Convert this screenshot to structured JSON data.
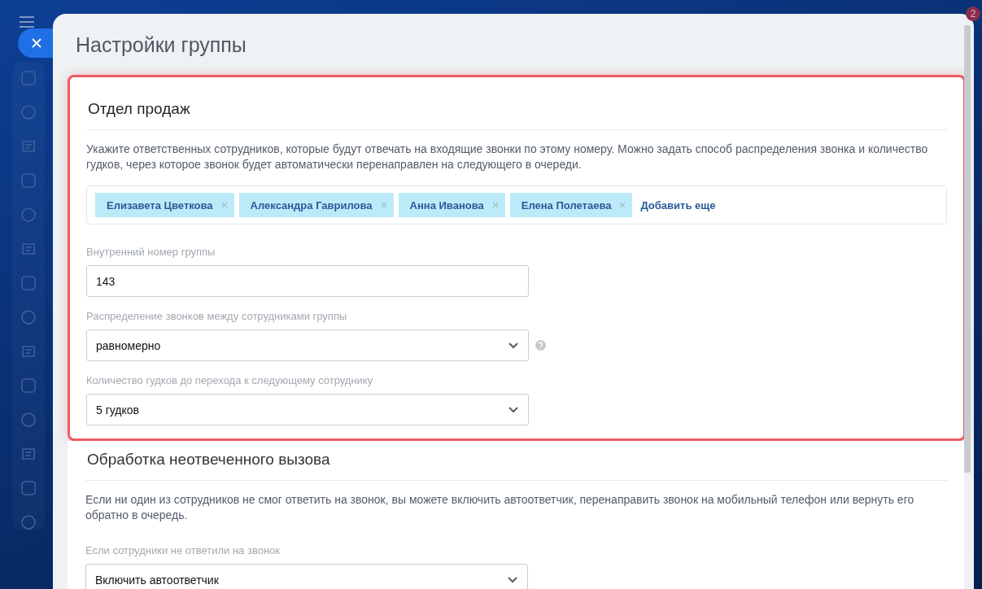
{
  "notification_badge": "2",
  "panel": {
    "title": "Настройки группы"
  },
  "group_card": {
    "title": "Отдел продаж",
    "description": "Укажите ответственных сотрудников, которые будут отвечать на входящие звонки по этому номеру. Можно задать способ распределения звонка и количество гудков, через которое звонок будет автоматически перенаправлен на следующего в очереди.",
    "members": [
      {
        "name": "Елизавета Цветкова"
      },
      {
        "name": "Александра Гаврилова"
      },
      {
        "name": "Анна Иванова"
      },
      {
        "name": "Елена Полетаева"
      }
    ],
    "add_link": "Добавить еще",
    "fields": [
      {
        "kind": "input",
        "label": "Внутренний номер группы",
        "value": "143",
        "help": false
      },
      {
        "kind": "select",
        "label": "Распределение звонков между сотрудниками группы",
        "value": "равномерно",
        "help": true
      },
      {
        "kind": "select",
        "label": "Количество гудков до перехода к следующему сотруднику",
        "value": "5 гудков",
        "help": false
      }
    ]
  },
  "unanswered_section": {
    "title": "Обработка неотвеченного вызова",
    "description": "Если ни один из сотрудников не смог ответить на звонок, вы можете включить автоответчик, перенаправить звонок на мобильный телефон или вернуть его обратно в очередь.",
    "fields": [
      {
        "kind": "select",
        "label": "Если сотрудники не ответили на звонок",
        "value": "Включить автоответчик",
        "help": false
      }
    ]
  }
}
